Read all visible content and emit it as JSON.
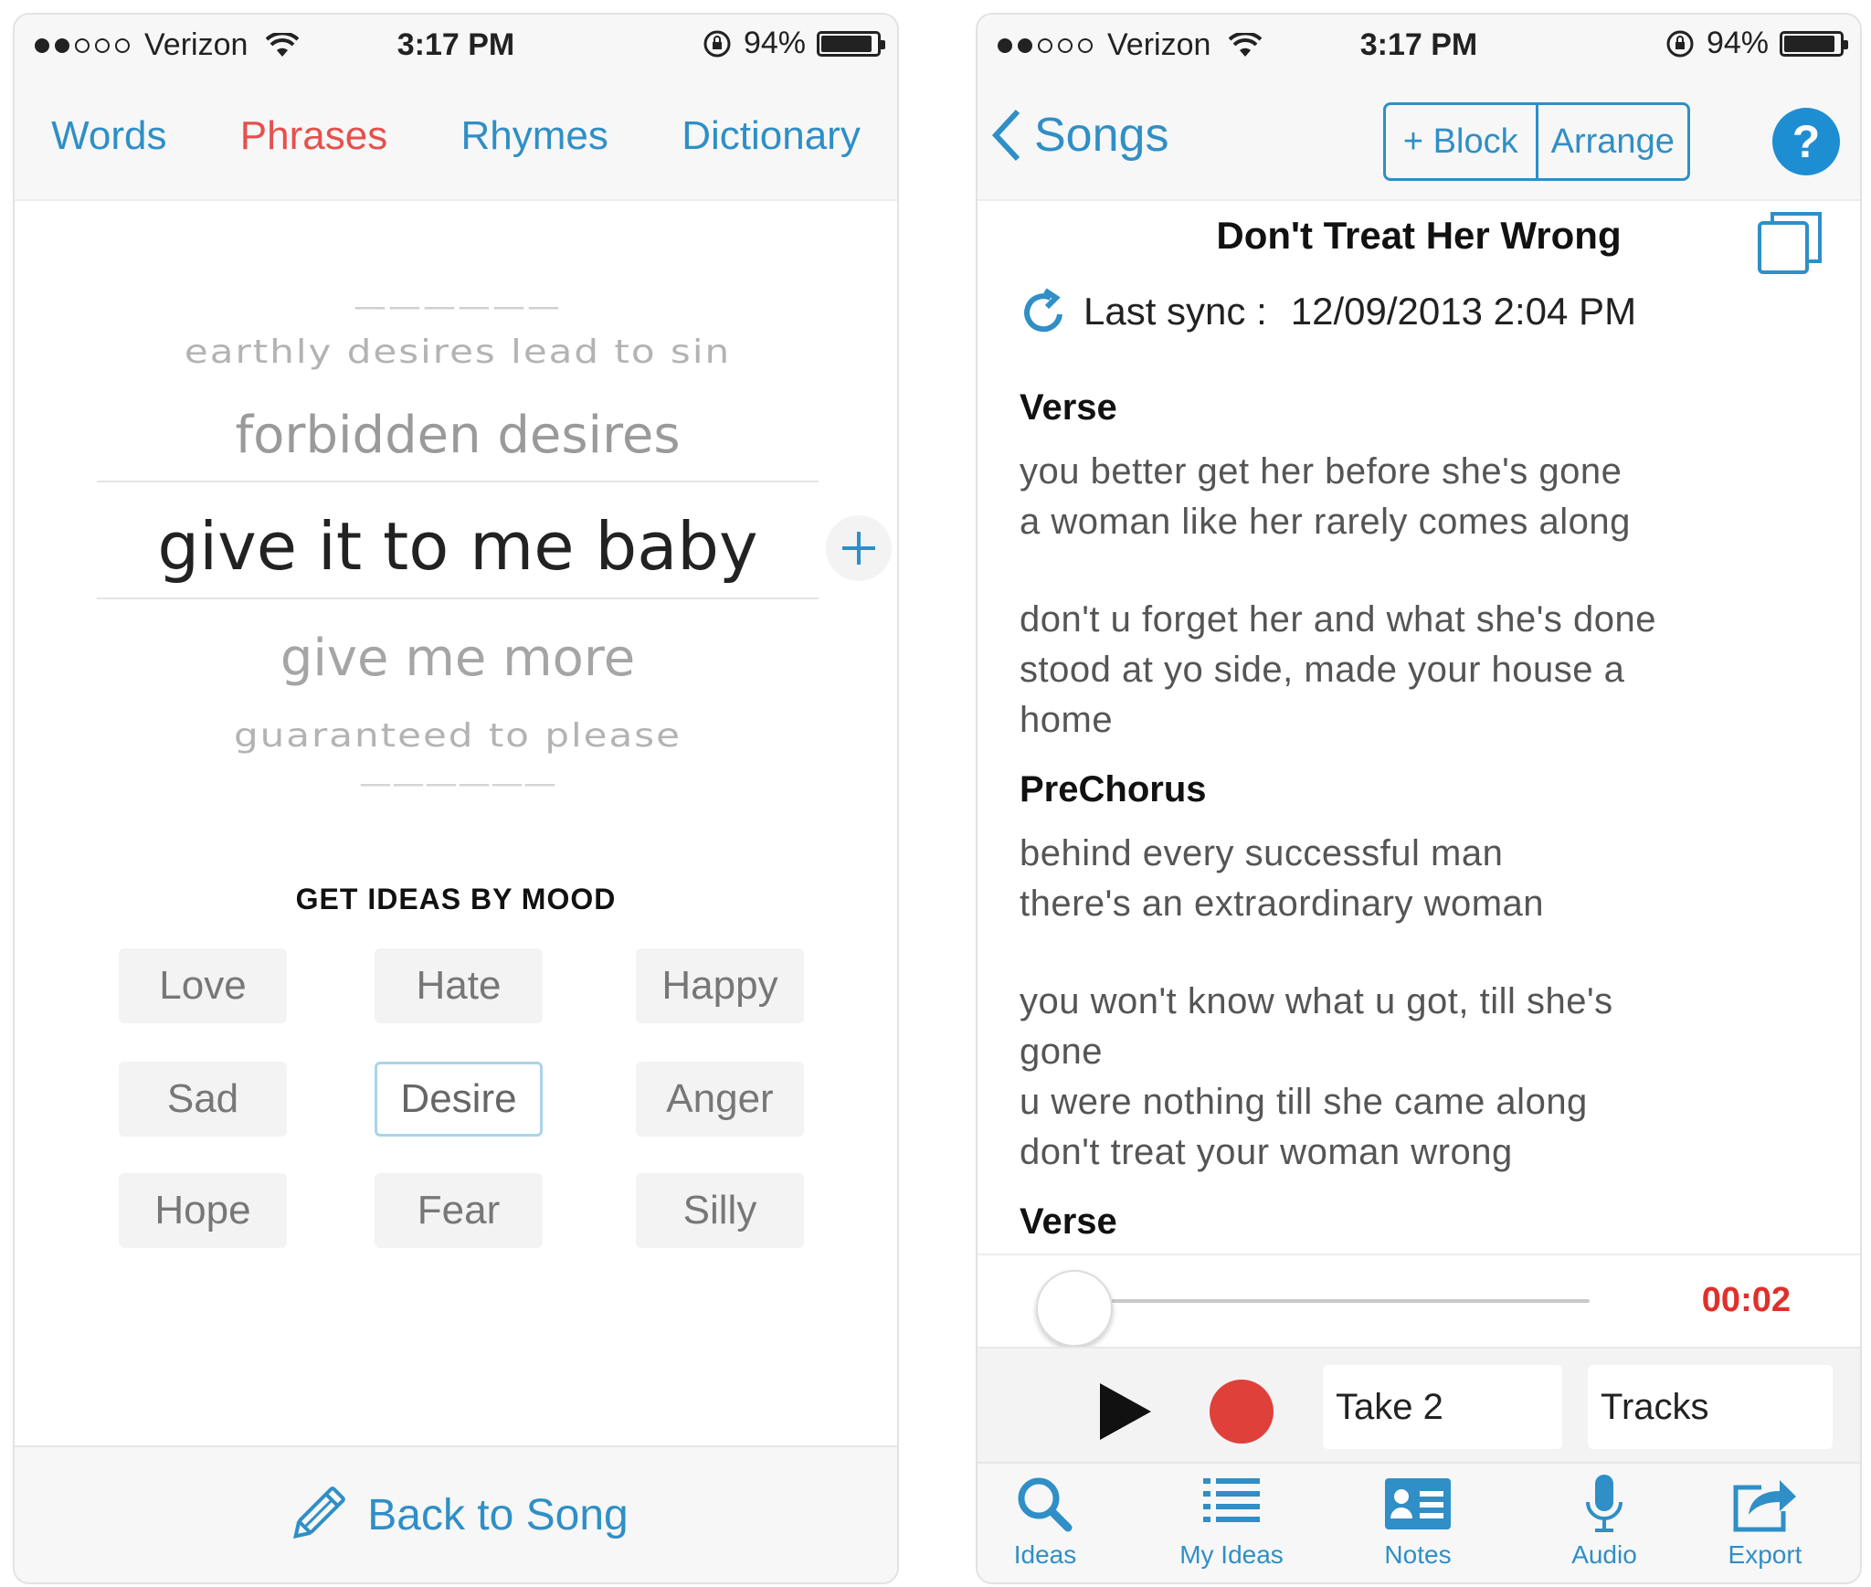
{
  "status_bar": {
    "carrier": "Verizon",
    "time": "3:17 PM",
    "battery": "94%"
  },
  "left_screen": {
    "tabs": [
      {
        "label": "Words",
        "active": false
      },
      {
        "label": "Phrases",
        "active": true
      },
      {
        "label": "Rhymes",
        "active": false
      },
      {
        "label": "Dictionary",
        "active": false
      }
    ],
    "picker": {
      "row_above_2": "earthly desires lead to sin",
      "row_above_1": "forbidden desires",
      "selected": "give it to me baby",
      "row_below_1": "give me more",
      "row_below_2": "guaranteed to please"
    },
    "mood_title": "GET IDEAS BY MOOD",
    "moods": [
      "Love",
      "Hate",
      "Happy",
      "Sad",
      "Desire",
      "Anger",
      "Hope",
      "Fear",
      "Silly"
    ],
    "selected_mood": "Desire",
    "back_label": "Back to Song"
  },
  "right_screen": {
    "back_label": "Songs",
    "add_block_label": "+ Block",
    "arrange_label": "Arrange",
    "help_label": "?",
    "song_title": "Don't Treat Her Wrong",
    "sync_label": "Last sync :",
    "sync_date": "12/09/2013 2:04 PM",
    "sections": [
      {
        "title": "Verse",
        "stanzas": [
          [
            "you better get her before she's gone",
            "a woman like her rarely comes along"
          ],
          [
            "don't u forget her and what she's done",
            "stood at yo side, made your house a",
            "home"
          ]
        ]
      },
      {
        "title": "PreChorus",
        "stanzas": [
          [
            "behind every successful man",
            "there's an extraordinary  woman"
          ],
          [
            "you won't know what u got, till she's",
            "gone",
            "u were nothing till she came along",
            "don't treat your woman wrong"
          ]
        ]
      },
      {
        "title": "Verse",
        "stanzas": []
      }
    ],
    "player_time": "00:02",
    "take_label": "Take 2",
    "tracks_label": "Tracks",
    "tabbar": [
      "Ideas",
      "My Ideas",
      "Notes",
      "Audio",
      "Export"
    ]
  },
  "colors": {
    "accent": "#2f8fc6",
    "active_tab": "#e4514d",
    "record": "#e0403a",
    "timer": "#e0302c"
  }
}
